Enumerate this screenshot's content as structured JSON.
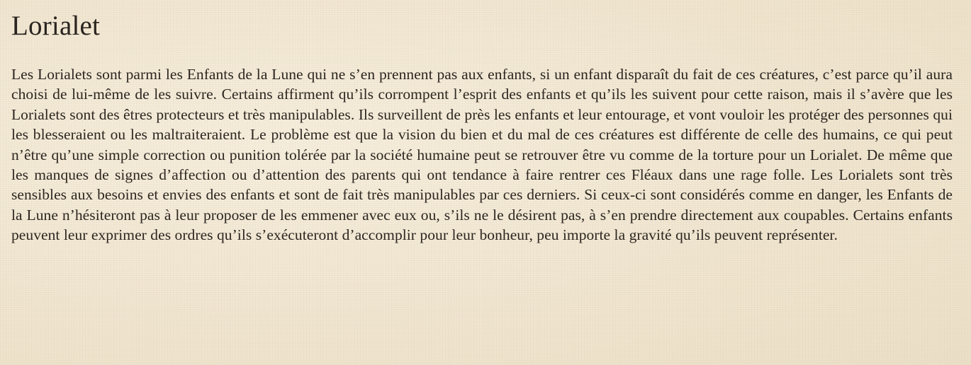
{
  "article": {
    "title": "Lorialet",
    "body": "Les Lorialets sont parmi les Enfants de la Lune qui ne s’en prennent pas aux enfants, si un enfant disparaît du fait de ces créatures, c’est parce qu’il aura choisi de lui-même de les suivre. Certains affirment qu’ils  corrompent l’esprit des enfants et qu’ils les suivent pour cette raison, mais il s’avère que les Lorialets sont des êtres protecteurs et très manipulables. Ils surveillent de près les enfants et leur entourage, et vont vouloir les protéger des personnes qui les blesseraient ou les maltraiteraient. Le problème est que la vision du bien et du mal de ces créatures est différente de celle des humains, ce qui peut n’être qu’une simple correction ou punition tolérée par la société humaine peut se retrouver être vu comme de la torture pour un Lorialet. De même que les manques de signes d’affection ou d’attention des parents qui ont tendance à faire rentrer ces Fléaux dans une rage folle. Les Lorialets sont très sensibles aux besoins et envies des enfants et sont de fait très manipulables par ces derniers. Si ceux-ci sont considérés comme en danger, les Enfants de la Lune n’hésiteront pas à leur proposer de les emmener avec eux ou, s’ils ne le désirent pas, à s’en prendre directement aux coupables. Certains enfants peuvent leur exprimer des ordres qu’ils s’exécuteront d’accomplir pour leur bonheur, peu importe la gravité qu’ils peuvent représenter."
  }
}
